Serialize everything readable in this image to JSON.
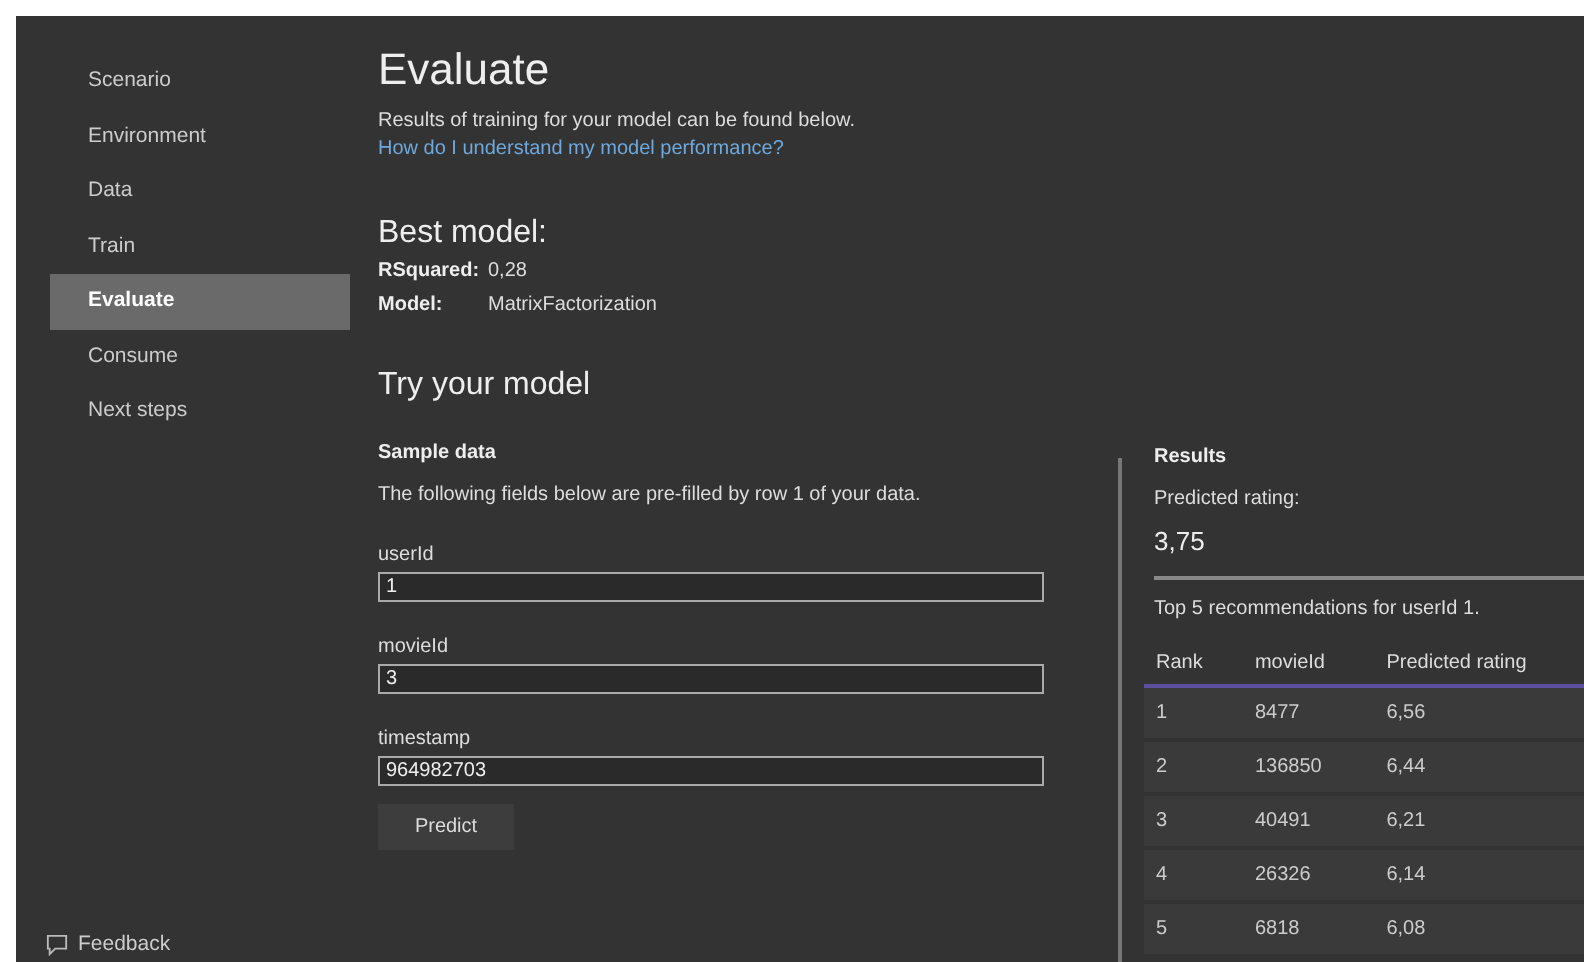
{
  "sidebar": {
    "items": [
      {
        "label": "Scenario",
        "selected": false
      },
      {
        "label": "Environment",
        "selected": false
      },
      {
        "label": "Data",
        "selected": false
      },
      {
        "label": "Train",
        "selected": false
      },
      {
        "label": "Evaluate",
        "selected": true
      },
      {
        "label": "Consume",
        "selected": false
      },
      {
        "label": "Next steps",
        "selected": false
      }
    ],
    "feedback": "Feedback"
  },
  "page": {
    "title": "Evaluate",
    "intro": "Results of training for your model can be found below.",
    "help_link": "How do I understand my model performance?"
  },
  "best_model": {
    "heading": "Best model:",
    "metrics": [
      {
        "label": "RSquared:",
        "value": "0,28"
      },
      {
        "label": "Model:",
        "value": "MatrixFactorization"
      }
    ]
  },
  "try_model": {
    "heading": "Try your model",
    "sample_heading": "Sample data",
    "description": "The following fields below are pre-filled by row 1 of your data.",
    "fields": [
      {
        "label": "userId",
        "value": "1"
      },
      {
        "label": "movieId",
        "value": "3"
      },
      {
        "label": "timestamp",
        "value": "964982703"
      }
    ],
    "predict_button": "Predict"
  },
  "results": {
    "heading": "Results",
    "predicted_label": "Predicted rating:",
    "predicted_value": "3,75",
    "top_label": "Top 5 recommendations for userId 1.",
    "table": {
      "columns": [
        "Rank",
        "movieId",
        "Predicted rating"
      ],
      "rows": [
        [
          "1",
          "8477",
          "6,56"
        ],
        [
          "2",
          "136850",
          "6,44"
        ],
        [
          "3",
          "40491",
          "6,21"
        ],
        [
          "4",
          "26326",
          "6,14"
        ],
        [
          "5",
          "6818",
          "6,08"
        ]
      ]
    }
  }
}
